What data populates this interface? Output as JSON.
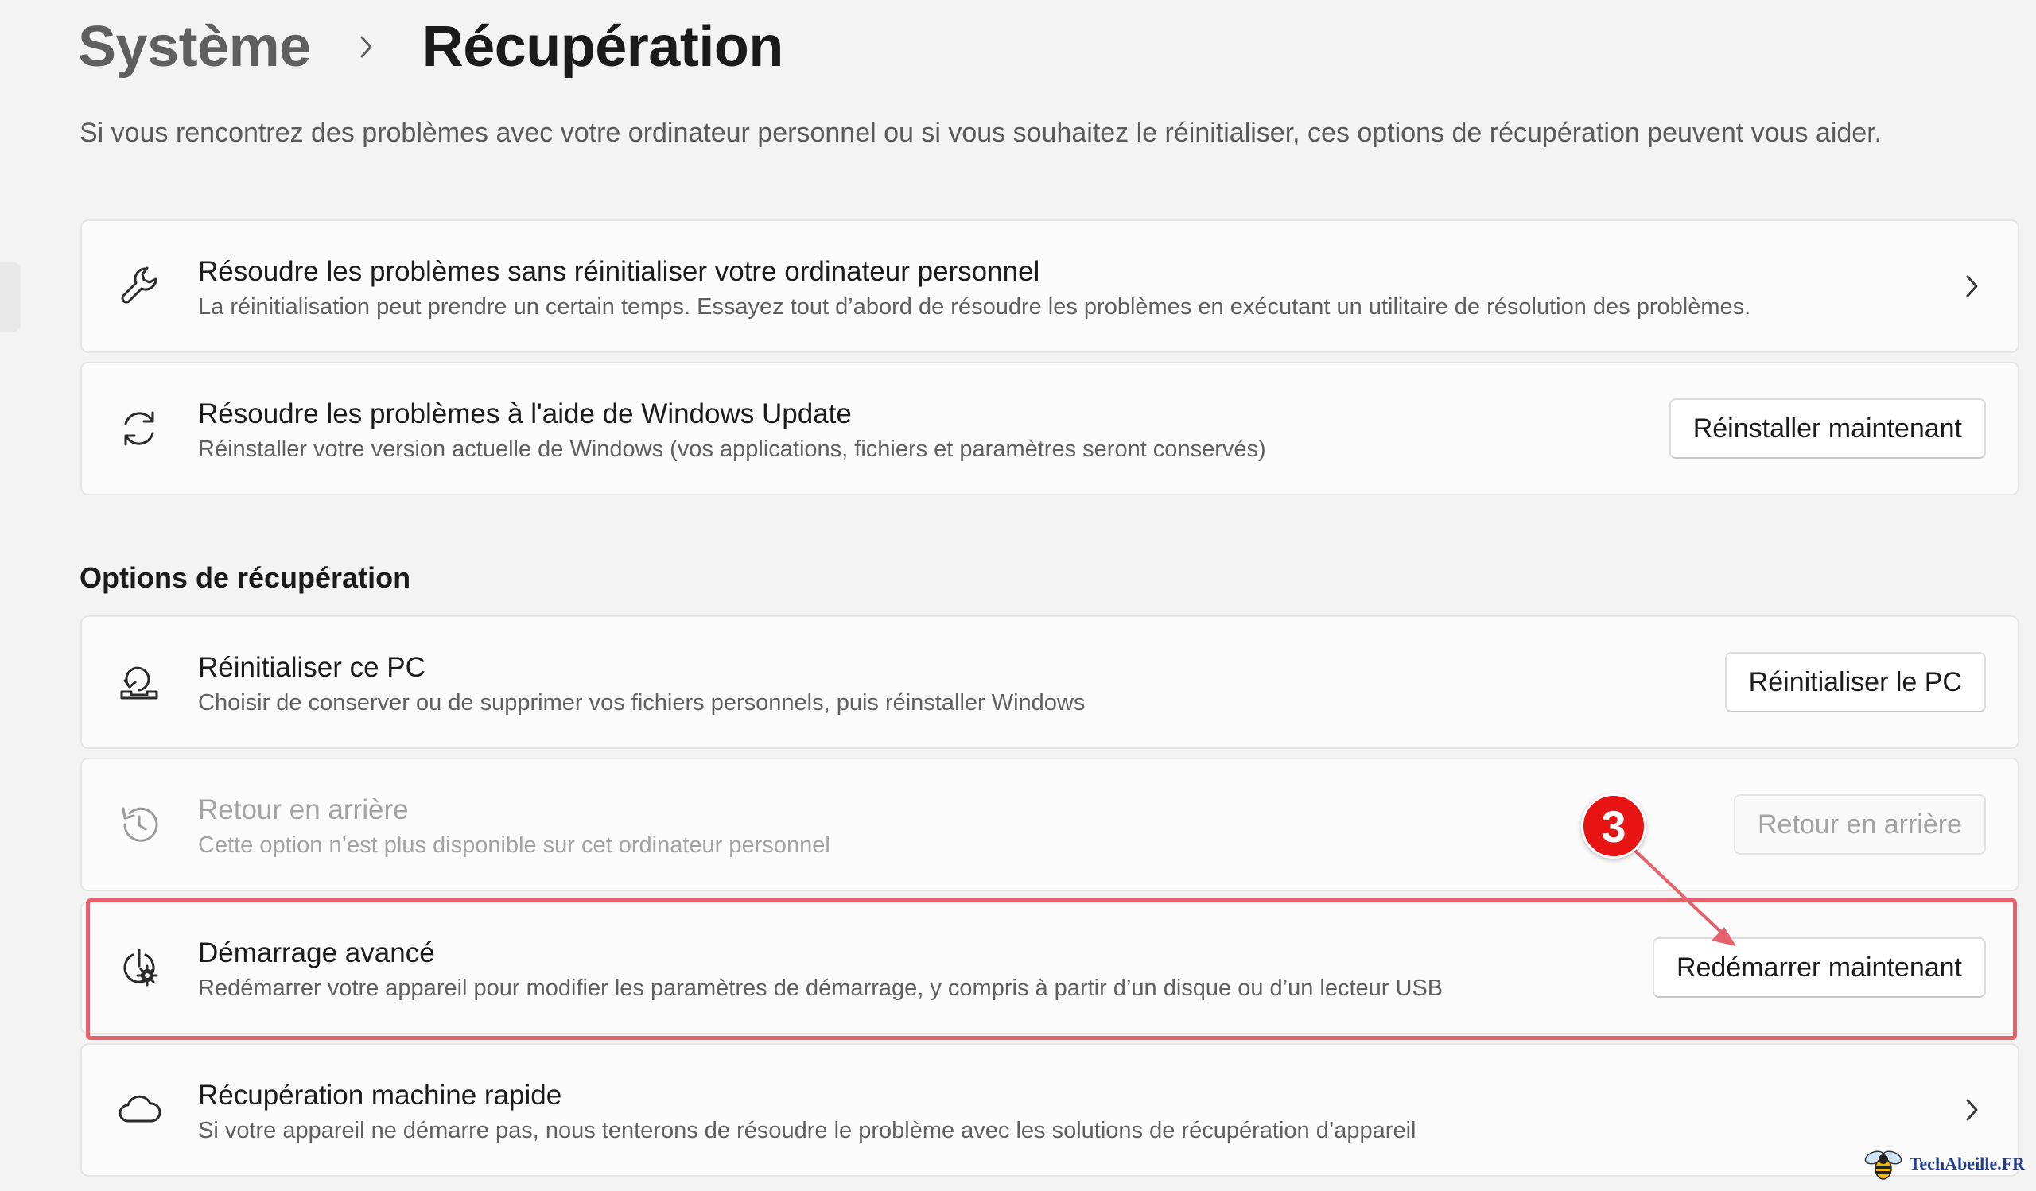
{
  "breadcrumb": {
    "parent": "Système",
    "current": "Récupération"
  },
  "intro": "Si vous rencontrez des problèmes avec votre ordinateur personnel ou si vous souhaitez le réinitialiser, ces options de récupération peuvent vous aider.",
  "top_cards": [
    {
      "icon": "wrench-icon",
      "title": "Résoudre les problèmes sans réinitialiser votre ordinateur personnel",
      "description": "La réinitialisation peut prendre un certain temps. Essayez tout d’abord de résoudre les problèmes en exécutant un utilitaire de résolution des problèmes."
    },
    {
      "icon": "sync-icon",
      "title": "Résoudre les problèmes à l'aide de Windows Update",
      "description": "Réinstaller votre version actuelle de Windows (vos applications, fichiers et paramètres seront conservés)",
      "button": "Réinstaller maintenant"
    }
  ],
  "recovery_section": {
    "heading": "Options de récupération",
    "items": [
      {
        "icon": "reset-pc-icon",
        "title": "Réinitialiser ce PC",
        "description": "Choisir de conserver ou de supprimer vos fichiers personnels, puis réinstaller Windows",
        "button": "Réinitialiser le PC"
      },
      {
        "icon": "history-icon",
        "title": "Retour en arrière",
        "description": "Cette option n’est plus disponible sur cet ordinateur personnel",
        "button": "Retour en arrière",
        "disabled": true
      },
      {
        "icon": "advanced-startup-icon",
        "title": "Démarrage avancé",
        "description": "Redémarrer votre appareil pour modifier les paramètres de démarrage, y compris à partir d’un disque ou d’un lecteur USB",
        "button": "Redémarrer maintenant"
      },
      {
        "icon": "cloud-icon",
        "title": "Récupération machine rapide",
        "description": "Si votre appareil ne démarre pas, nous tenterons de résoudre le problème avec les solutions de récupération d’appareil"
      }
    ]
  },
  "annotation": {
    "step_number": "3",
    "color": "#e81414",
    "highlight_color": "#e5616b"
  },
  "watermark": {
    "text": "TechAbeille.FR"
  }
}
